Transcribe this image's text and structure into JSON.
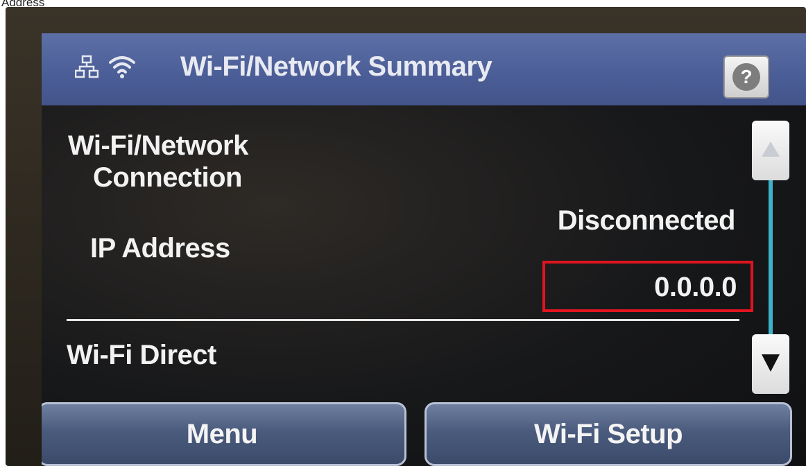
{
  "page_caption": "Address",
  "header": {
    "title": "Wi-Fi/Network Summary",
    "icons": [
      "network-icon",
      "wifi-icon"
    ],
    "help_label": "?"
  },
  "rows": {
    "connection_label_line1": "Wi-Fi/Network",
    "connection_label_line2": "Connection",
    "connection_value": "Disconnected",
    "ip_label": "IP Address",
    "ip_value": "0.0.0.0",
    "wifi_direct_label": "Wi-Fi Direct"
  },
  "buttons": {
    "menu": "Menu",
    "wifi_setup": "Wi-Fi Setup"
  },
  "colors": {
    "title_bar": "#4b5d96",
    "highlight": "#e0141e",
    "scroll_track": "#3db2c8"
  }
}
